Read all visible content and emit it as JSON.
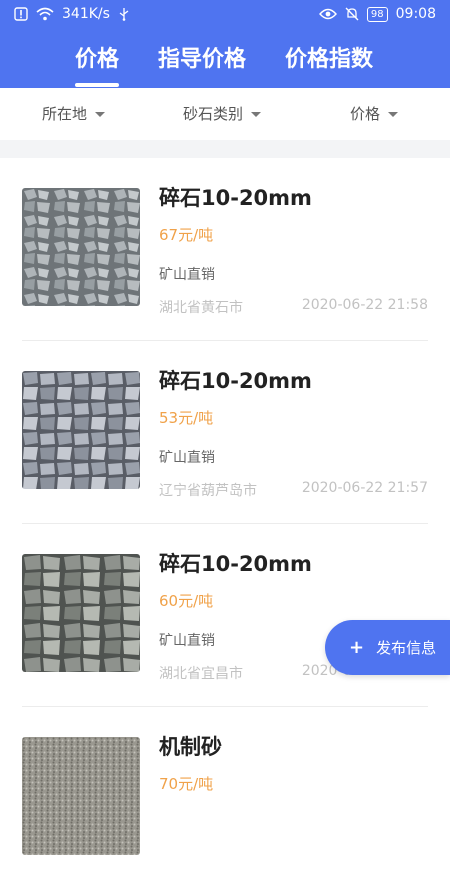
{
  "status_bar": {
    "network_speed": "341K/s",
    "battery": "98",
    "time": "09:08"
  },
  "tabs": [
    {
      "label": "价格",
      "active": true
    },
    {
      "label": "指导价格",
      "active": false
    },
    {
      "label": "价格指数",
      "active": false
    }
  ],
  "filters": [
    {
      "label": "所在地"
    },
    {
      "label": "砂石类别"
    },
    {
      "label": "价格"
    }
  ],
  "items": [
    {
      "title": "碎石10-20mm",
      "price": "67元/吨",
      "source": "矿山直销",
      "location": "湖北省黄石市",
      "time": "2020-06-22 21:58"
    },
    {
      "title": "碎石10-20mm",
      "price": "53元/吨",
      "source": "矿山直销",
      "location": "辽宁省葫芦岛市",
      "time": "2020-06-22 21:57"
    },
    {
      "title": "碎石10-20mm",
      "price": "60元/吨",
      "source": "矿山直销",
      "location": "湖北省宜昌市",
      "time": "2020-06-22 21:56"
    },
    {
      "title": "机制砂",
      "price": "70元/吨",
      "source": "",
      "location": "",
      "time": ""
    }
  ],
  "fab": {
    "label": "发布信息"
  },
  "colors": {
    "accent": "#4f74f0",
    "price": "#f0a24a"
  }
}
